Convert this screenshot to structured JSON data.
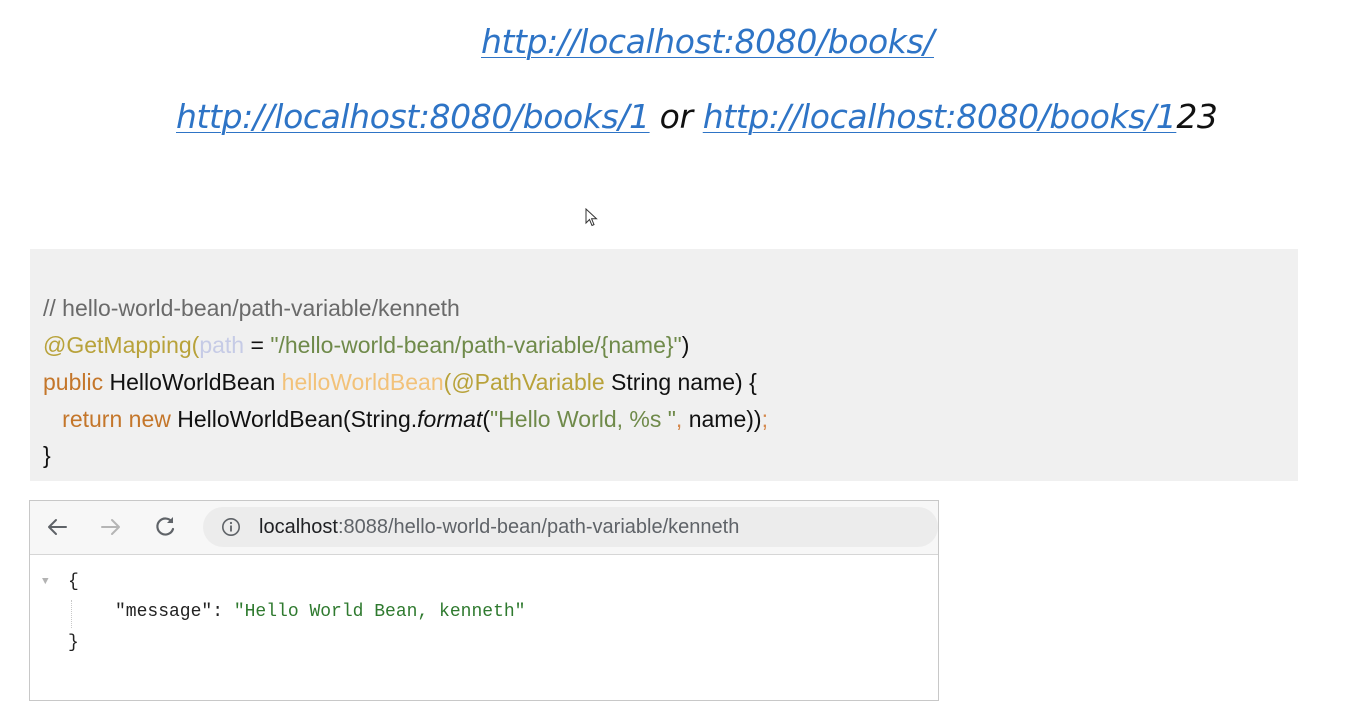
{
  "slide": {
    "line1": {
      "link": "http://localhost:8080/books/"
    },
    "line2": {
      "link_a": "http://localhost:8080/books/1",
      "connector": " or ",
      "link_b": "http://localhost:8080/books/1",
      "suffix": "23"
    }
  },
  "code": {
    "comment": "// hello-world-bean/path-variable/kenneth",
    "line2": {
      "annotation": "@GetMapping",
      "open_paren": "(",
      "param": "path",
      "equals": " = ",
      "value": "\"/hello-world-bean/path-variable/{name}\"",
      "close_paren": ")"
    },
    "line3": {
      "kw_public": "public",
      "type": " HelloWorldBean ",
      "method": "helloWorldBean",
      "open_paren": "(",
      "annotation": "@PathVariable",
      "args": " String name) {"
    },
    "line4": {
      "indent": "   ",
      "kw_return": "return",
      "space": " ",
      "kw_new": "new",
      "ctor": " HelloWorldBean(String.",
      "format": "format",
      "open": "(",
      "string": "\"Hello World, %s \"",
      "comma": ",",
      "rest": " name))",
      "semi": ";"
    },
    "line5": "}"
  },
  "browser": {
    "url_host": "localhost",
    "url_path": ":8088/hello-world-bean/path-variable/kenneth",
    "icons": [
      "back-arrow-icon",
      "forward-arrow-icon",
      "reload-icon",
      "info-icon",
      "collapse-triangle-icon"
    ],
    "json": {
      "open": "{",
      "key": "\"message\"",
      "colon": ": ",
      "value": "\"Hello World Bean, kenneth\"",
      "close": "}"
    }
  },
  "colors": {
    "link": "#2e74c6",
    "code_bg": "#f0f0f0",
    "annotation": "#b8a23a",
    "string": "#6f8a4a",
    "keyword": "#c4762a",
    "method": "#f2c27a",
    "json_string": "#2f7a2f"
  }
}
